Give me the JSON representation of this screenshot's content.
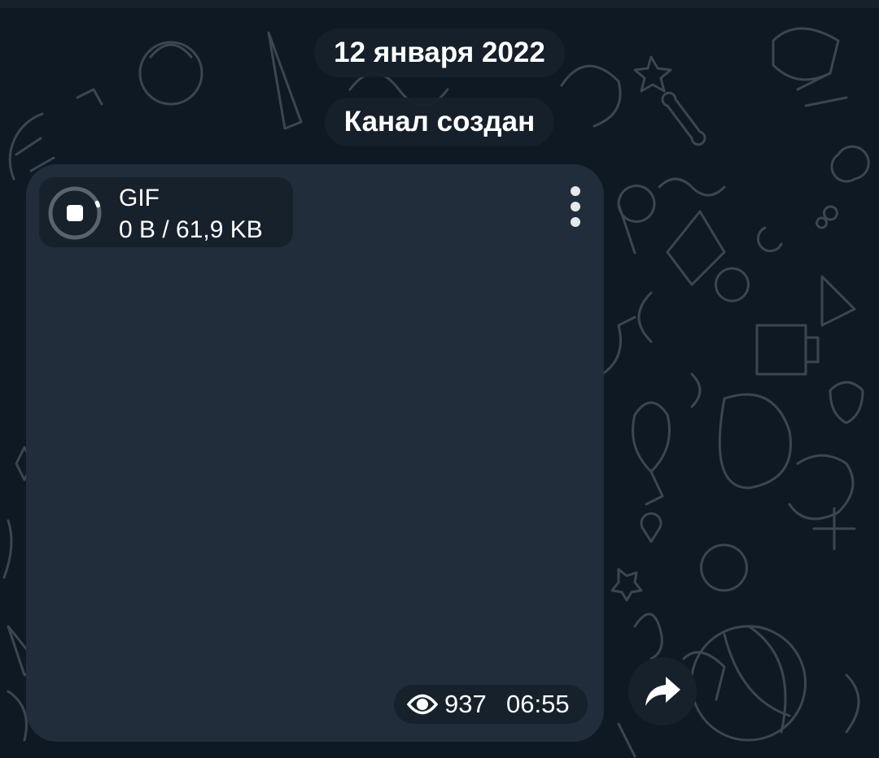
{
  "chat": {
    "date_label": "12 января 2022",
    "service_message": "Канал создан"
  },
  "message": {
    "media": {
      "type_label": "GIF",
      "download_status": "0 B / 61,9 KB",
      "progress": 0.02
    },
    "views": "937",
    "time": "06:55",
    "icons": {
      "views": "eye-icon",
      "menu": "more-vertical-icon",
      "cancel_download": "stop-icon",
      "forward": "forward-arrow-icon"
    }
  },
  "colors": {
    "background": "#0f1923",
    "bubble": "#212d3b",
    "overlay": "#17212b",
    "text": "#ffffff",
    "pattern": "#3b4650"
  }
}
